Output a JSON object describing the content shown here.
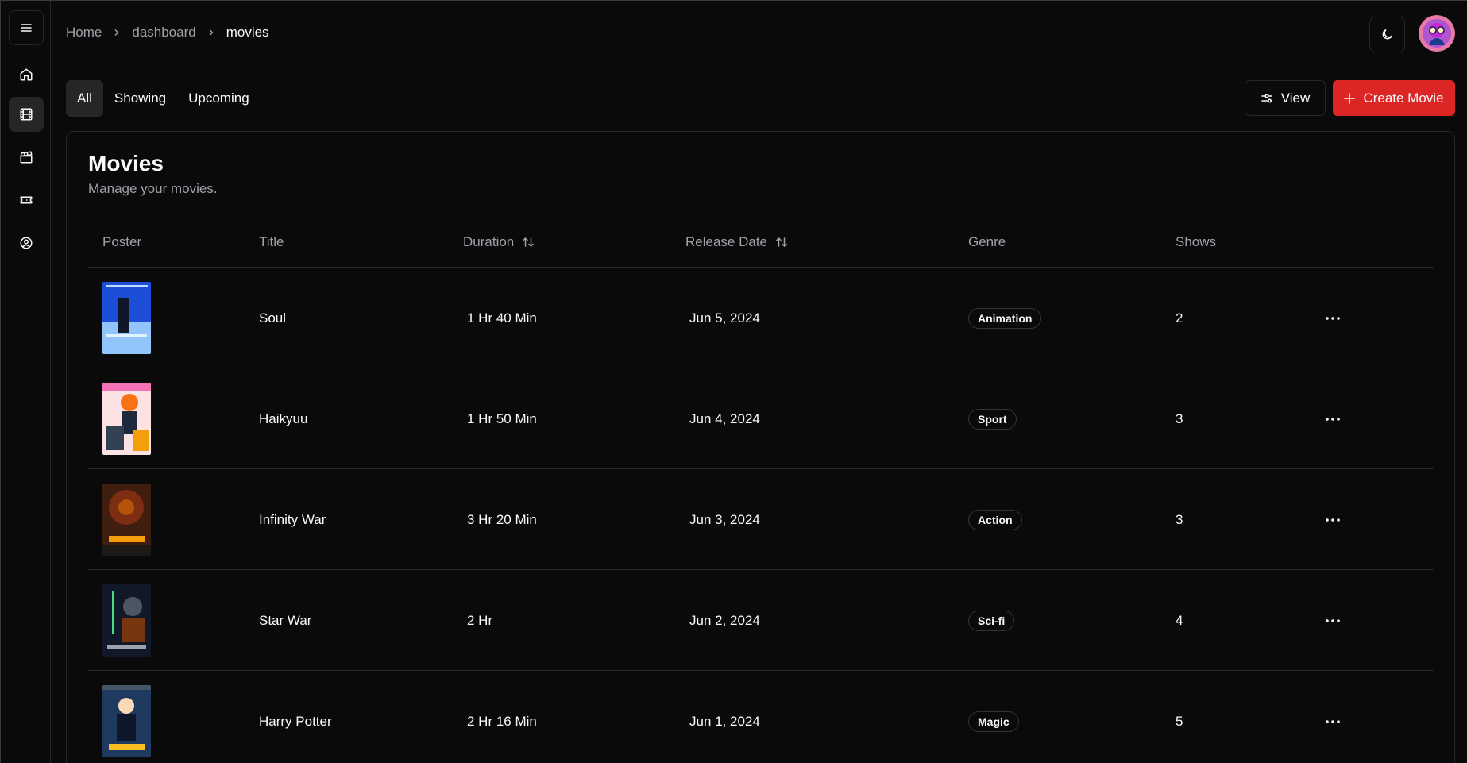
{
  "breadcrumb": {
    "home": "Home",
    "dashboard": "dashboard",
    "current": "movies"
  },
  "tabs": [
    "All",
    "Showing",
    "Upcoming"
  ],
  "actions": {
    "view_label": "View",
    "create_label": "Create Movie"
  },
  "card": {
    "title": "Movies",
    "subtitle": "Manage your movies."
  },
  "table": {
    "columns": {
      "poster": "Poster",
      "title": "Title",
      "duration": "Duration",
      "release_date": "Release Date",
      "genre": "Genre",
      "shows": "Shows"
    },
    "rows": [
      {
        "title": "Soul",
        "duration": "1 Hr 40 Min",
        "release_date": "Jun 5, 2024",
        "genre": "Animation",
        "shows": "2"
      },
      {
        "title": "Haikyuu",
        "duration": "1 Hr 50 Min",
        "release_date": "Jun 4, 2024",
        "genre": "Sport",
        "shows": "3"
      },
      {
        "title": "Infinity War",
        "duration": "3 Hr 20 Min",
        "release_date": "Jun 3, 2024",
        "genre": "Action",
        "shows": "3"
      },
      {
        "title": "Star War",
        "duration": "2 Hr",
        "release_date": "Jun 2, 2024",
        "genre": "Sci-fi",
        "shows": "4"
      },
      {
        "title": "Harry Potter",
        "duration": "2 Hr 16 Min",
        "release_date": "Jun 1, 2024",
        "genre": "Magic",
        "shows": "5"
      }
    ]
  },
  "icons": {
    "sidebar": [
      "home-icon",
      "film-icon",
      "clapperboard-icon",
      "ticket-icon",
      "user-circle-icon"
    ],
    "header": [
      "menu-icon",
      "moon-icon",
      "avatar"
    ]
  },
  "colors": {
    "accent": "#dc2626",
    "background": "#0a0a0a",
    "border": "#262626",
    "muted_text": "#a1a1aa"
  }
}
